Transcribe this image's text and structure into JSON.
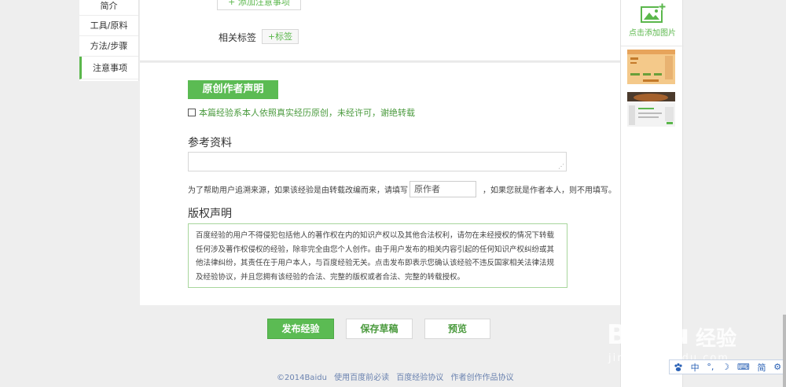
{
  "left_nav": {
    "items": [
      {
        "label": "简介"
      },
      {
        "label": "工具/原料"
      },
      {
        "label": "方法/步骤"
      },
      {
        "label": "注意事项"
      }
    ]
  },
  "top_panel": {
    "add_note_label": "+ 添加注意事项",
    "tags_label": "相关标签",
    "tags_button": "+标签"
  },
  "original": {
    "badge": "原创作者声明",
    "checkbox_text": "本篇经验系本人依照真实经历原创，未经许可，谢绝转载"
  },
  "references": {
    "title": "参考资料",
    "input_value": "",
    "source_prefix": "为了帮助用户追溯来源，如果该经验是由转载改编而来，请填写",
    "author_placeholder": "原作者",
    "source_suffix": "，如果您就是作者本人，则不用填写。"
  },
  "copyright": {
    "title": "版权声明",
    "text": "百度经验的用户不得侵犯包括他人的著作权在内的知识产权以及其他合法权利，请勿在未经授权的情况下转载任何涉及著作权侵权的经验，除非完全由您个人创作。由于用户发布的相关内容引起的任何知识产权纠纷或其他法律纠纷，其责任在于用户本人，与百度经验无关。点击发布即表示您确认该经验不违反国家相关法律法规及经验协议，并且您拥有该经验的合法、完整的版权或者合法、完整的转载授权。"
  },
  "actions": {
    "publish": "发布经验",
    "save_draft": "保存草稿",
    "preview": "预览"
  },
  "footer": {
    "copyright": "©2014Baidu",
    "links": [
      "使用百度前必读",
      "百度经验协议",
      "作者创作作品协议"
    ]
  },
  "sidebar": {
    "add_image_label": "点击添加图片"
  },
  "watermark": {
    "brand": "Baidu",
    "product": "经验",
    "url": "jingyan.baidu.com"
  },
  "ime": {
    "items": [
      "中",
      "°,",
      "☽",
      "⌨",
      "简",
      "⚙"
    ]
  },
  "colors": {
    "accent_green": "#5bbb53",
    "link_blue": "#6b83b0"
  }
}
